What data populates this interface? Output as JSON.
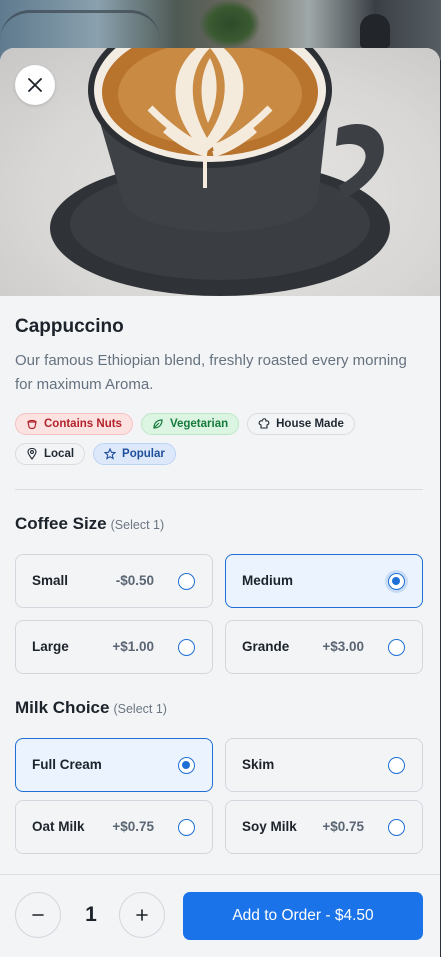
{
  "product": {
    "title": "Cappuccino",
    "description": "Our famous Ethiopian blend, freshly roasted every morning for maximum Aroma."
  },
  "tags": [
    {
      "label": "Contains Nuts",
      "icon": "nut-icon",
      "style": "red"
    },
    {
      "label": "Vegetarian",
      "icon": "leaf-icon",
      "style": "green"
    },
    {
      "label": "House Made",
      "icon": "chef-hat-icon",
      "style": "plain"
    },
    {
      "label": "Local",
      "icon": "location-pin-icon",
      "style": "plain"
    },
    {
      "label": "Popular",
      "icon": "star-icon",
      "style": "blue"
    }
  ],
  "coffee_size": {
    "title": "Coffee Size",
    "hint": "(Select 1)",
    "options": [
      {
        "name": "Small",
        "price": "-$0.50",
        "selected": false
      },
      {
        "name": "Medium",
        "price": "",
        "selected": true
      },
      {
        "name": "Large",
        "price": "+$1.00",
        "selected": false
      },
      {
        "name": "Grande",
        "price": "+$3.00",
        "selected": false
      }
    ]
  },
  "milk_choice": {
    "title": "Milk Choice",
    "hint": "(Select 1)",
    "options": [
      {
        "name": "Full Cream",
        "price": "",
        "selected": true
      },
      {
        "name": "Skim",
        "price": "",
        "selected": false
      },
      {
        "name": "Oat Milk",
        "price": "+$0.75",
        "selected": false
      },
      {
        "name": "Soy Milk",
        "price": "+$0.75",
        "selected": false
      }
    ]
  },
  "footer": {
    "quantity": "1",
    "add_label": "Add to Order - $4.50"
  },
  "colors": {
    "accent": "#1a73e8",
    "selected_bg": "#eaf3fe",
    "background": "#f3f4f6"
  }
}
